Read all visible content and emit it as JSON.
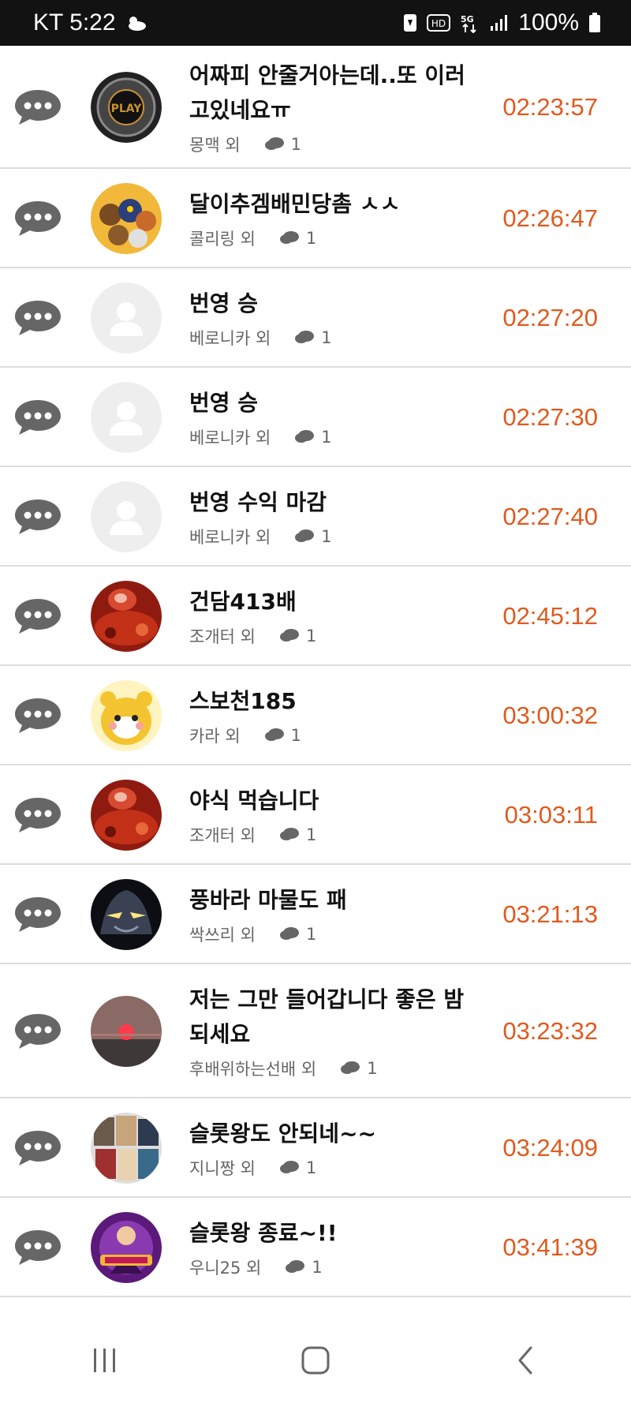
{
  "status_bar": {
    "carrier_time": "KT 5:22",
    "battery": "100%",
    "icons": [
      "weather-cloud-icon",
      "sim-icon",
      "hd-icon",
      "5g-icon",
      "signal-icon",
      "battery-icon"
    ]
  },
  "colors": {
    "time": "#e05a1e",
    "title": "#111111",
    "meta": "#666666",
    "chat_icon": "#666666",
    "divider": "#dcdcdc"
  },
  "chat_rows": [
    {
      "title": "어짜피 안줄거아는데..또 이러고있네요ㅠ",
      "author": "몽맥 외",
      "count": "1",
      "time": "02:23:57",
      "avatar": "play-logo-avatar"
    },
    {
      "title": "달이추겜배민당촘 ㅅㅅ",
      "author": "콜리링 외",
      "count": "1",
      "time": "02:26:47",
      "avatar": "cartoon-group-avatar"
    },
    {
      "title": "번영 승",
      "author": "베로니카 외",
      "count": "1",
      "time": "02:27:20",
      "avatar": "default-user-avatar"
    },
    {
      "title": "번영 승",
      "author": "베로니카 외",
      "count": "1",
      "time": "02:27:30",
      "avatar": "default-user-avatar"
    },
    {
      "title": "번영 수익 마감",
      "author": "베로니카 외",
      "count": "1",
      "time": "02:27:40",
      "avatar": "default-user-avatar"
    },
    {
      "title": "건담413배",
      "author": "조개터 외",
      "count": "1",
      "time": "02:45:12",
      "avatar": "red-food-avatar"
    },
    {
      "title": "스보천185",
      "author": "카라 외",
      "count": "1",
      "time": "03:00:32",
      "avatar": "tiger-cub-avatar"
    },
    {
      "title": "야식 먹습니다",
      "author": "조개터 외",
      "count": "1",
      "time": "03:03:11",
      "avatar": "red-food-avatar"
    },
    {
      "title": "풍바라 마물도 패",
      "author": "싹쓰리 외",
      "count": "1",
      "time": "03:21:13",
      "avatar": "dark-helmet-avatar"
    },
    {
      "title": "저는 그만 들어갑니다 좋은 밤되세요",
      "author": "후배위하는선배 외",
      "count": "1",
      "time": "03:23:32",
      "avatar": "sunset-avatar"
    },
    {
      "title": "슬롯왕도 안되네~~",
      "author": "지니짱 외",
      "count": "1",
      "time": "03:24:09",
      "avatar": "collage-avatar"
    },
    {
      "title": "슬롯왕 종료~!!",
      "author": "우니25 외",
      "count": "1",
      "time": "03:41:39",
      "avatar": "slot-game-avatar"
    }
  ],
  "nav": {
    "buttons": [
      "recents-button",
      "home-button",
      "back-button"
    ]
  }
}
